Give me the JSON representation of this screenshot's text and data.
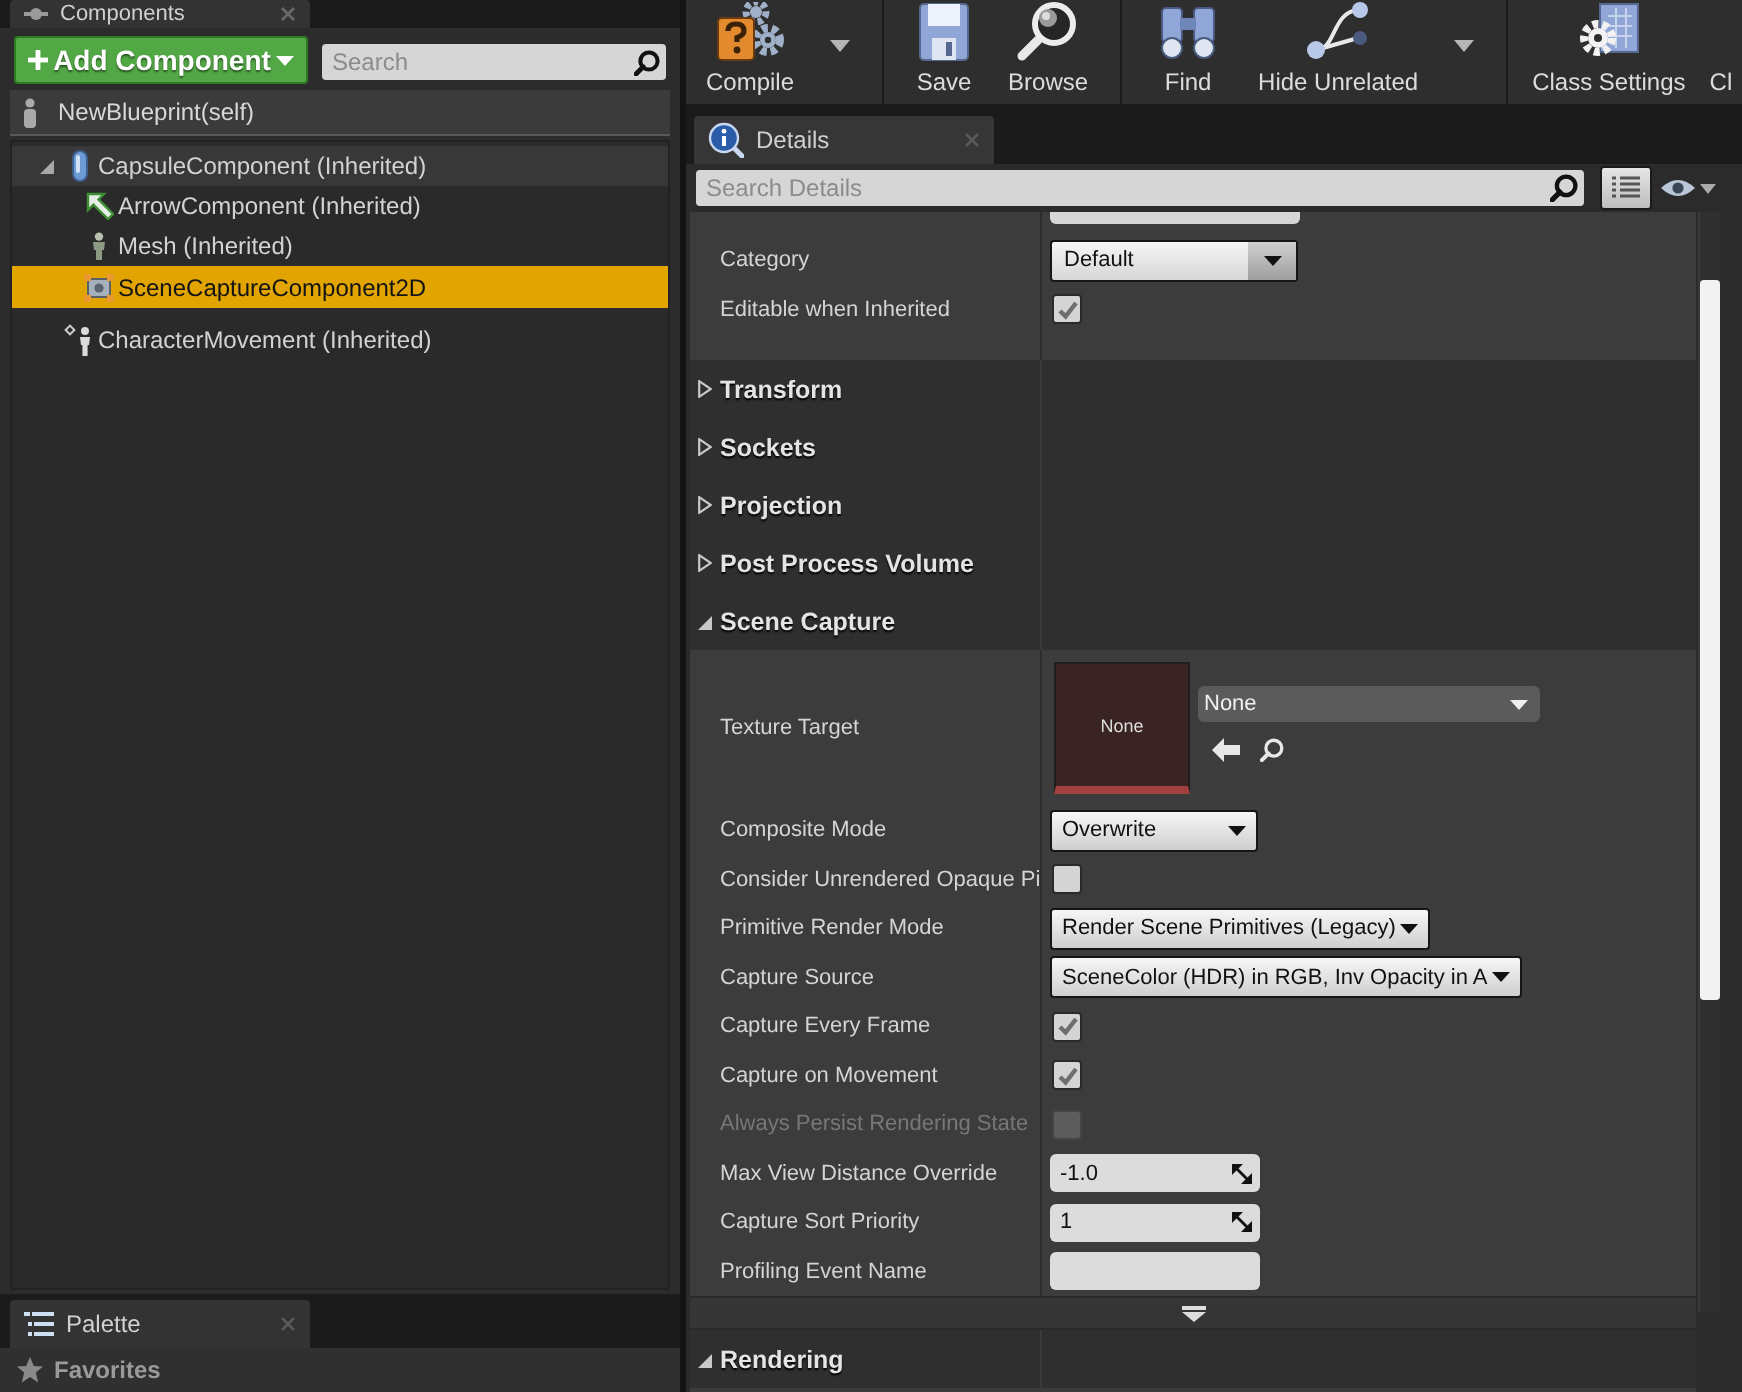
{
  "components_panel": {
    "tab": {
      "title": "Components"
    },
    "add_button": {
      "label": "Add Component"
    },
    "search": {
      "placeholder": "Search"
    },
    "root": {
      "label": "NewBlueprint(self)"
    },
    "tree": [
      {
        "label": "CapsuleComponent (Inherited)",
        "kind": "capsule",
        "expanded": true,
        "selected": false,
        "hovered": true,
        "children": [
          {
            "label": "ArrowComponent (Inherited)",
            "kind": "arrow",
            "selected": false,
            "hovered": false
          },
          {
            "label": "Mesh (Inherited)",
            "kind": "mesh",
            "selected": false,
            "hovered": false
          },
          {
            "label": "SceneCaptureComponent2D",
            "kind": "capture",
            "selected": true,
            "hovered": false
          }
        ]
      },
      {
        "label": "CharacterMovement (Inherited)",
        "kind": "movement",
        "selected": false,
        "hovered": false
      }
    ]
  },
  "palette_panel": {
    "tab": {
      "title": "Palette"
    },
    "category": {
      "label": "Favorites"
    }
  },
  "toolbar": {
    "groups": [
      [
        {
          "kind": "compile",
          "label": "Compile"
        },
        {
          "kind": "menu"
        }
      ],
      [
        {
          "kind": "save",
          "label": "Save"
        },
        {
          "kind": "browse",
          "label": "Browse"
        }
      ],
      [
        {
          "kind": "find",
          "label": "Find"
        },
        {
          "kind": "hide_unrelated",
          "label": "Hide Unrelated"
        },
        {
          "kind": "menu"
        }
      ],
      [
        {
          "kind": "class_settings",
          "label": "Class Settings"
        },
        {
          "kind": "partial",
          "label": "Cl"
        }
      ]
    ]
  },
  "details": {
    "tab": {
      "title": "Details"
    },
    "search": {
      "placeholder": "Search Details"
    },
    "rows": [
      {
        "kind": "text",
        "partial": true
      },
      {
        "kind": "combo",
        "label": "Category",
        "value": "Default"
      },
      {
        "kind": "checkbox",
        "label": "Editable when Inherited",
        "checked": true,
        "disabled": false
      },
      {
        "kind": "category",
        "label": "Transform",
        "expanded": false
      },
      {
        "kind": "category",
        "label": "Sockets",
        "expanded": false
      },
      {
        "kind": "category",
        "label": "Projection",
        "expanded": false
      },
      {
        "kind": "category",
        "label": "Post Process Volume",
        "expanded": false
      },
      {
        "kind": "category",
        "label": "Scene Capture",
        "expanded": true
      },
      {
        "kind": "texture",
        "label": "Texture Target",
        "thumbnail": "None",
        "value": "None"
      },
      {
        "kind": "dropdown",
        "label": "Composite Mode",
        "value": "Overwrite"
      },
      {
        "kind": "checkbox",
        "label": "Consider Unrendered Opaque Pi",
        "checked": false,
        "disabled": false
      },
      {
        "kind": "dropdown",
        "label": "Primitive Render Mode",
        "value": "Render Scene Primitives (Legacy)"
      },
      {
        "kind": "dropdown",
        "label": "Capture Source",
        "value": "SceneColor (HDR) in RGB, Inv Opacity in A"
      },
      {
        "kind": "checkbox",
        "label": "Capture Every Frame",
        "checked": true,
        "disabled": false
      },
      {
        "kind": "checkbox",
        "label": "Capture on Movement",
        "checked": true,
        "disabled": false
      },
      {
        "kind": "checkbox",
        "label": "Always Persist Rendering State",
        "checked": false,
        "disabled": true
      },
      {
        "kind": "number",
        "label": "Max View Distance Override",
        "value": "-1.0"
      },
      {
        "kind": "number",
        "label": "Capture Sort Priority",
        "value": "1"
      },
      {
        "kind": "text",
        "label": "Profiling Event Name",
        "partial": false
      },
      {
        "kind": "advanced",
        "expanded": false
      },
      {
        "kind": "category",
        "label": "Rendering",
        "expanded": true
      }
    ]
  }
}
